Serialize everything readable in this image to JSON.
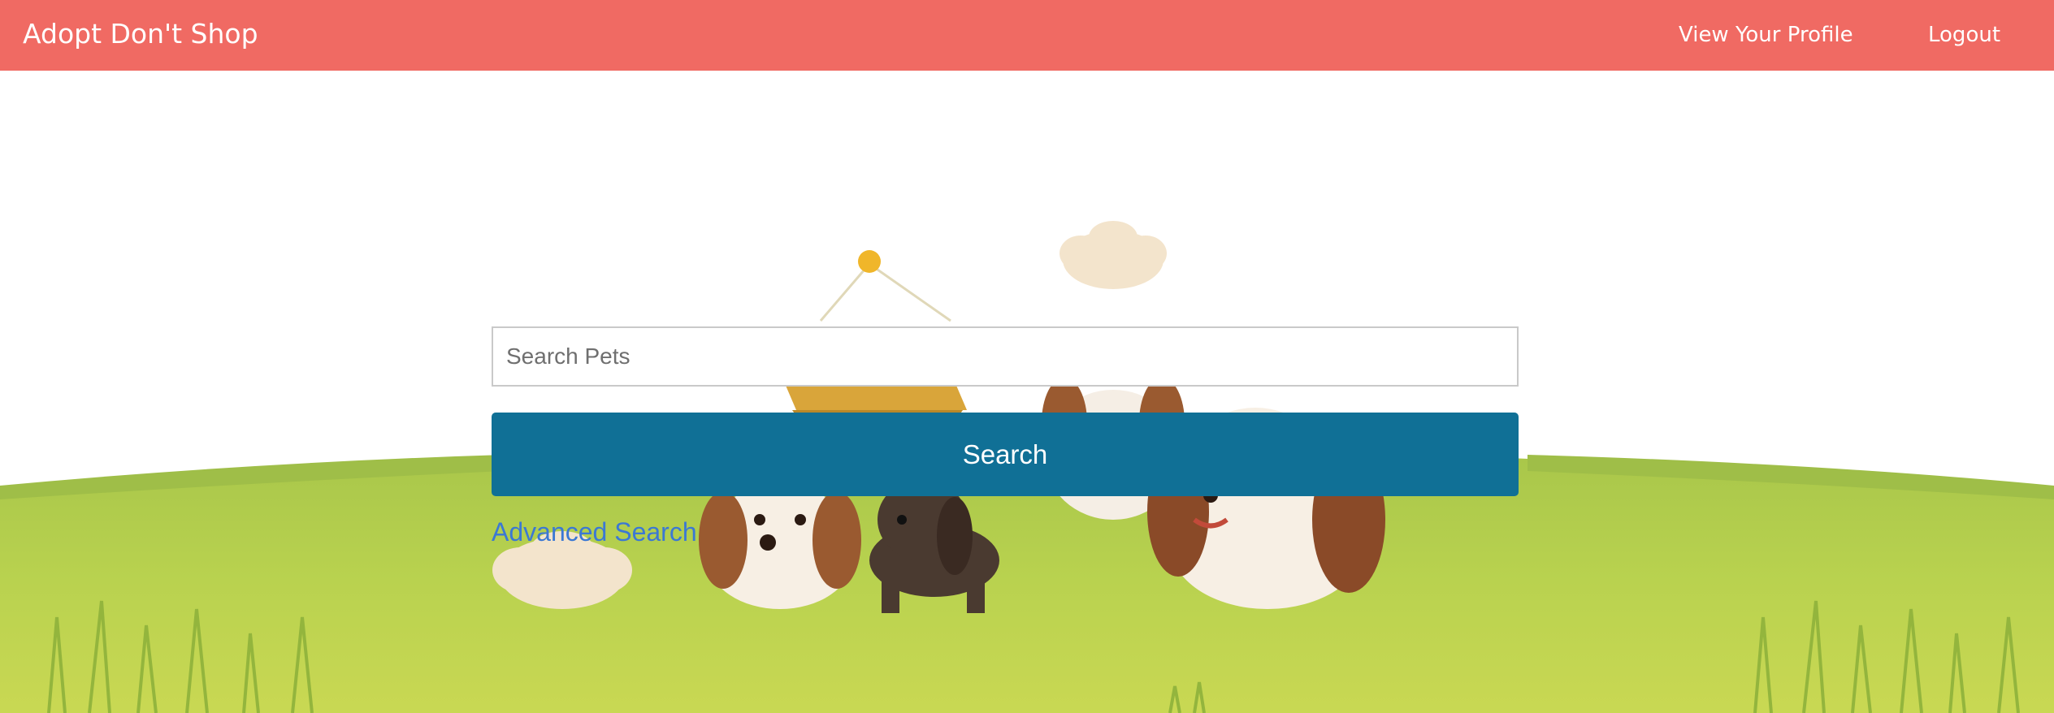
{
  "navbar": {
    "brand": "Adopt Don't Shop",
    "links": {
      "profile": "View Your Profile",
      "logout": "Logout"
    },
    "color": "#f06a63"
  },
  "search": {
    "placeholder": "Search Pets",
    "value": "",
    "button_label": "Search",
    "button_color": "#107096",
    "advanced_link": "Advanced Search",
    "link_color": "#3b78d4"
  },
  "hero": {
    "illustration": "cartoon-puppies-on-grass"
  }
}
